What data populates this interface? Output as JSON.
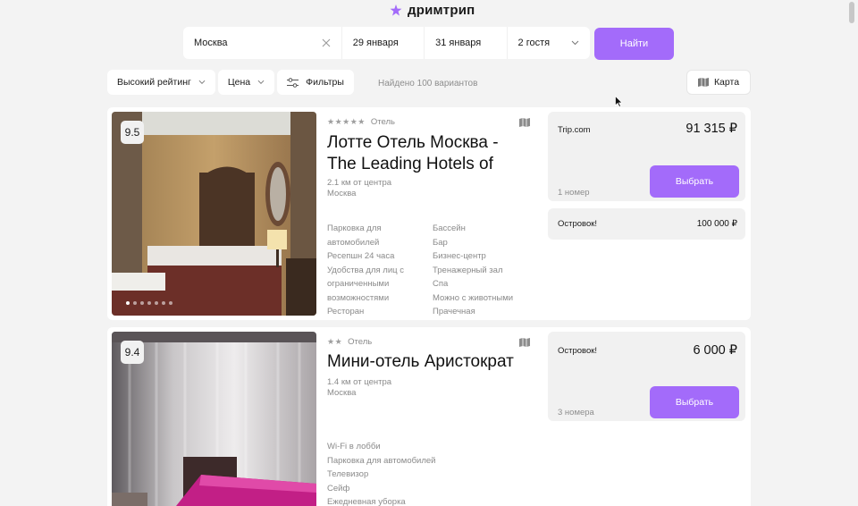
{
  "brand": {
    "name": "дримтрип",
    "accent": "#a36bfa"
  },
  "search": {
    "city": "Москва",
    "checkin": "29 января",
    "checkout": "31 января",
    "guests": "2 гостя",
    "submit_label": "Найти"
  },
  "filters": {
    "sort_label": "Высокий рейтинг",
    "price_label": "Цена",
    "filters_label": "Фильтры",
    "found_text": "Найдено 100 вариантов",
    "map_label": "Карта"
  },
  "hotels": [
    {
      "rating": "9.5",
      "stars": "★★★★★",
      "type": "Отель",
      "name": "Лотте Отель Москва - The Leading Hotels of",
      "distance": "2.1 км от центра",
      "city": "Москва",
      "amenities_left": [
        "Парковка для автомобилей",
        "Ресепшн 24 часа",
        "Удобства для лиц с ограниченными возможностями",
        "Ресторан"
      ],
      "amenities_right": [
        "Бассейн",
        "Бар",
        "Бизнес-центр",
        "Тренажерный зал",
        "Спа",
        "Можно с животными",
        "Прачечная"
      ],
      "photo_count": 7,
      "offers": [
        {
          "provider": "Trip.com",
          "price": "91 315 ₽",
          "rooms": "1 номер",
          "select_label": "Выбрать"
        },
        {
          "provider": "Островок!",
          "price": "100 000 ₽"
        }
      ]
    },
    {
      "rating": "9.4",
      "stars": "★★",
      "type": "Отель",
      "name": "Мини-отель Аристократ",
      "distance": "1.4 км от центра",
      "city": "Москва",
      "amenities_left": [
        "Wi-Fi в лобби",
        "Парковка для автомобилей",
        "Телевизор",
        "Сейф",
        "Ежедневная уборка"
      ],
      "offers": [
        {
          "provider": "Островок!",
          "price": "6 000 ₽",
          "rooms": "3 номера",
          "select_label": "Выбрать"
        }
      ]
    }
  ]
}
